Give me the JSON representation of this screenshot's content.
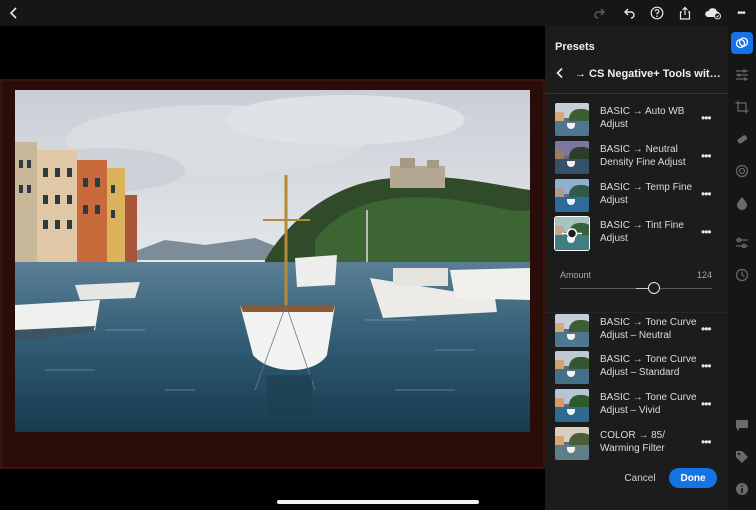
{
  "topbar": {
    "back_icon": "chevron-left-icon",
    "redo_icon": "redo-icon",
    "undo_icon": "undo-icon",
    "help_icon": "help-icon",
    "share_icon": "share-icon",
    "cloud_icon": "cloud-sync-icon",
    "more_label": "•••"
  },
  "panel": {
    "title": "Presets",
    "group_title": "→ CS Negative+ Tools with Spe...",
    "presets": [
      {
        "label": "BASIC → Auto WB Adjust",
        "more": "•••",
        "tint": "#9aa6ad"
      },
      {
        "label": "BASIC → Neutral Density Fine Adjust",
        "more": "•••",
        "tint": "#6e6a8f"
      },
      {
        "label": "BASIC → Temp Fine Adjust",
        "more": "•••",
        "tint": "#6b8fb3"
      },
      {
        "label": "BASIC → Tint Fine Adjust",
        "more": "•••",
        "tint": "#7a9f9a"
      },
      {
        "label": "BASIC → Tone Curve Adjust – Neutral",
        "more": "•••",
        "tint": "#9aa6ad"
      },
      {
        "label": "BASIC → Tone Curve Adjust – Standard",
        "more": "•••",
        "tint": "#8fa0a8"
      },
      {
        "label": "BASIC → Tone Curve Adjust – Vivid",
        "more": "•••",
        "tint": "#7f9fb5"
      },
      {
        "label": "COLOR → 85/ Warming Filter",
        "more": "•••",
        "tint": "#b5a48a"
      }
    ],
    "amount": {
      "label": "Amount",
      "value": "124",
      "level": 0.62
    },
    "cancel_label": "Cancel",
    "done_label": "Done"
  },
  "toolstrip": {
    "tools": [
      "presets-icon",
      "edit-sliders-icon",
      "crop-icon",
      "healing-icon",
      "masking-icon",
      "optics-icon",
      "versions-icon",
      "history-icon",
      "comments-icon",
      "tag-icon",
      "info-icon"
    ]
  },
  "colors": {
    "accent": "#1473e6",
    "panel_bg": "#1c1c1c",
    "film_border": "#2a0d08"
  }
}
